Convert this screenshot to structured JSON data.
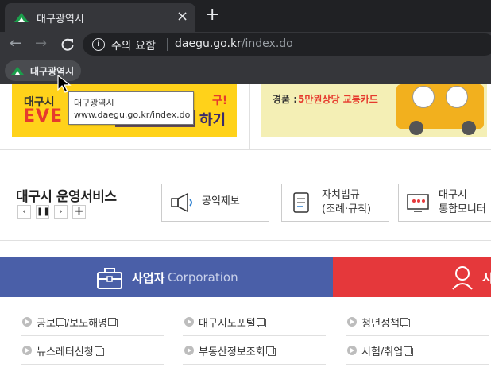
{
  "browser": {
    "tab_title": "대구광역시",
    "tab_close": "×",
    "new_tab": "+",
    "security_label": "주의 요함",
    "url_host": "daegu.go.kr",
    "url_path": "/index.do",
    "bookmark_label": "대구광역시"
  },
  "tooltip": {
    "title": "대구광역시",
    "url": "www.daegu.go.kr/index.do"
  },
  "banners": {
    "left_top": "대구시",
    "left_event": "EVE",
    "left_frag_top": "구!",
    "left_frag_bottom": "하기",
    "right_prize_label": "경품 :",
    "right_prize_value": "5만원상당 교통카드"
  },
  "services": {
    "title": "대구시 운영서비스",
    "controls": [
      "‹",
      "❚❚",
      "›",
      "+"
    ],
    "items": [
      {
        "label": "공익제보"
      },
      {
        "line1": "자치법규",
        "line2": "(조례·규칙)"
      },
      {
        "line1": "대구시",
        "line2": "통합모니터"
      }
    ]
  },
  "tabs": {
    "business_strong": "사업자",
    "business_light": "Corporation",
    "red_label": "시"
  },
  "links": {
    "col1": [
      "공보",
      "/보도해명",
      "뉴스레터신청"
    ],
    "col2": [
      "대구지도포털",
      "부동산정보조회"
    ],
    "col3": [
      "청년정책",
      "시험/취업"
    ]
  },
  "colors": {
    "business_tab": "#4a5fa8",
    "red_tab": "#e5383b",
    "banner_yellow": "#ffd21a"
  }
}
